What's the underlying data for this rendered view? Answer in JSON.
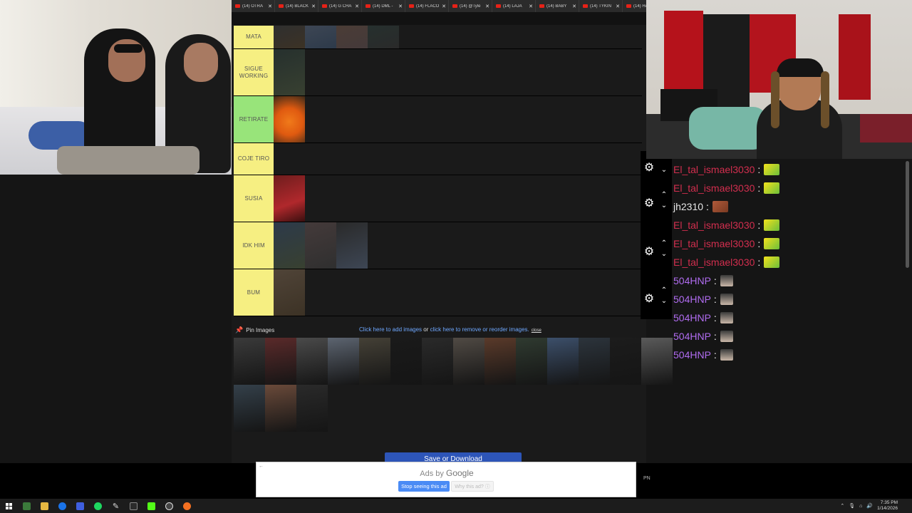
{
  "tabs": [
    {
      "label": "(14) OTRA"
    },
    {
      "label": "(14) BLACK"
    },
    {
      "label": "(14) G CHA"
    },
    {
      "label": "(14) DML -"
    },
    {
      "label": "(14) FLACO"
    },
    {
      "label": "(14) @Tyle"
    },
    {
      "label": "(14) LAJA"
    },
    {
      "label": "(14) BABY"
    },
    {
      "label": "(14) TYKIN"
    },
    {
      "label": "(14) HA"
    }
  ],
  "tiers": [
    {
      "label": "MATA",
      "color": "#f6ef82",
      "items": 4
    },
    {
      "label": "SIGUE WORKING",
      "color": "#f6ef82",
      "items": 1
    },
    {
      "label": "RETIRATE",
      "color": "#98e47a",
      "items": 1
    },
    {
      "label": "COJE TIRO",
      "color": "#f6ef82",
      "items": 0
    },
    {
      "label": "SUSIA",
      "color": "#f6ef82",
      "items": 1
    },
    {
      "label": "IDK HIM",
      "color": "#f6ef82",
      "items": 3
    },
    {
      "label": "BUM",
      "color": "#f6ef82",
      "items": 1
    }
  ],
  "pin": {
    "label": "Pin Images"
  },
  "add": {
    "part1": "Click here to add images",
    "mid": " or ",
    "part2": "click here to remove or reorder images.",
    "close": "close"
  },
  "pool_count": 17,
  "save_button": "Save or Download",
  "ad": {
    "ads_by": "Ads by",
    "google": "Google",
    "stop": "Stop seeing this ad",
    "why": "Why this ad?",
    "pn": "PN"
  },
  "chat": [
    {
      "user": "El_tal_ismael3030",
      "color": "#d22e4e"
    },
    {
      "user": "El_tal_ismael3030",
      "color": "#d22e4e"
    },
    {
      "user": "jh2310",
      "color": "#e7e7e7"
    },
    {
      "user": "El_tal_ismael3030",
      "color": "#d22e4e"
    },
    {
      "user": "El_tal_ismael3030",
      "color": "#d22e4e"
    },
    {
      "user": "El_tal_ismael3030",
      "color": "#d22e4e"
    },
    {
      "user": "504HNP",
      "color": "#b06cf0"
    },
    {
      "user": "504HNP",
      "color": "#b06cf0"
    },
    {
      "user": "504HNP",
      "color": "#b06cf0"
    },
    {
      "user": "504HNP",
      "color": "#b06cf0"
    },
    {
      "user": "504HNP",
      "color": "#b06cf0"
    }
  ],
  "clock": {
    "time": "7:35 PM",
    "date": "1/14/2026"
  }
}
